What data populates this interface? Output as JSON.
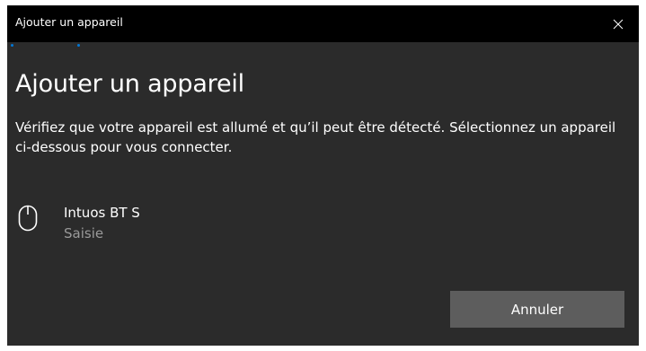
{
  "window": {
    "title": "Ajouter un appareil"
  },
  "dialog": {
    "heading": "Ajouter un appareil",
    "description": "Vérifiez que votre appareil est allumé et qu’il peut être détecté. Sélectionnez un appareil ci-dessous pour vous connecter."
  },
  "devices": [
    {
      "name": "Intuos BT S",
      "type": "Saisie",
      "icon": "mouse-icon"
    }
  ],
  "buttons": {
    "cancel_label": "Annuler"
  },
  "icons": {
    "close": "close-icon"
  },
  "colors": {
    "titlebar_bg": "#000000",
    "dialog_bg": "#2b2b2b",
    "text": "#ffffff",
    "secondary_text": "#9a9a9a",
    "button_bg": "#5d5d5d",
    "accent": "#0078d7"
  }
}
